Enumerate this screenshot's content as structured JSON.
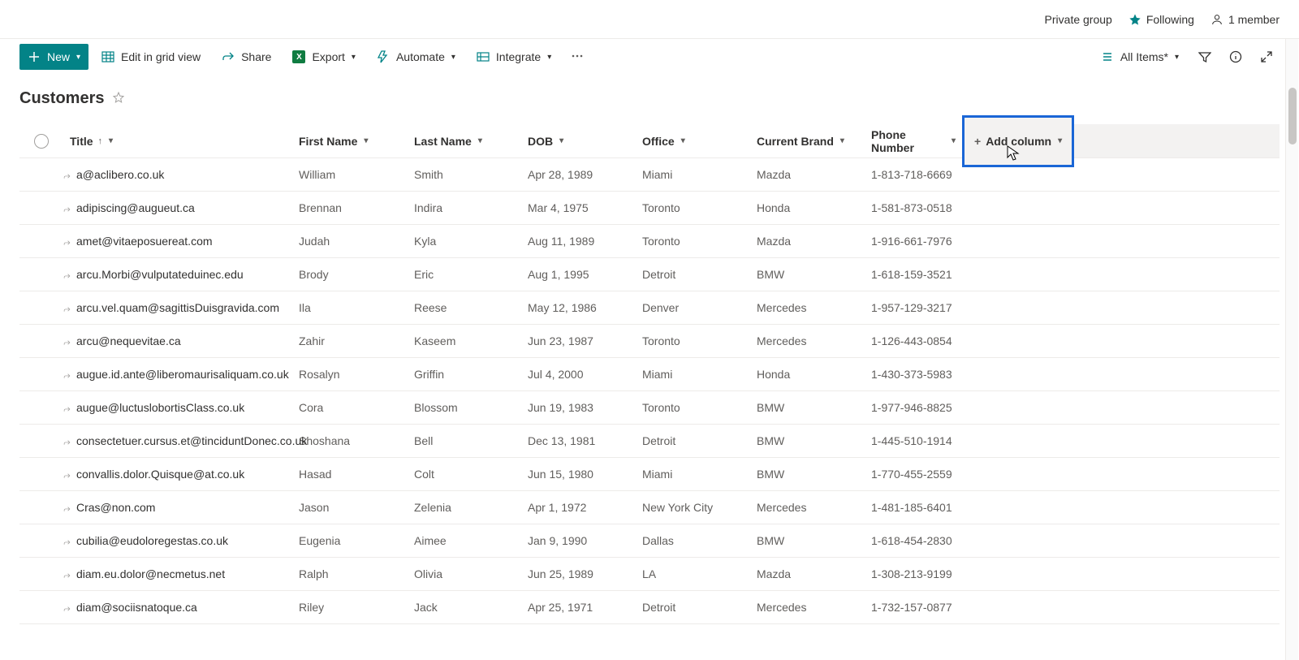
{
  "topbar": {
    "group_label": "Private group",
    "following_label": "Following",
    "members_label": "1 member"
  },
  "cmdbar": {
    "new": "New",
    "edit_grid": "Edit in grid view",
    "share": "Share",
    "export": "Export",
    "automate": "Automate",
    "integrate": "Integrate",
    "view_label": "All Items*"
  },
  "list": {
    "title": "Customers"
  },
  "columns": {
    "title": "Title",
    "first": "First Name",
    "last": "Last Name",
    "dob": "DOB",
    "office": "Office",
    "brand": "Current Brand",
    "phone": "Phone Number",
    "add": "Add column"
  },
  "rows": [
    {
      "title": "a@aclibero.co.uk",
      "first": "William",
      "last": "Smith",
      "dob": "Apr 28, 1989",
      "office": "Miami",
      "brand": "Mazda",
      "phone": "1-813-718-6669"
    },
    {
      "title": "adipiscing@augueut.ca",
      "first": "Brennan",
      "last": "Indira",
      "dob": "Mar 4, 1975",
      "office": "Toronto",
      "brand": "Honda",
      "phone": "1-581-873-0518"
    },
    {
      "title": "amet@vitaeposuereat.com",
      "first": "Judah",
      "last": "Kyla",
      "dob": "Aug 11, 1989",
      "office": "Toronto",
      "brand": "Mazda",
      "phone": "1-916-661-7976"
    },
    {
      "title": "arcu.Morbi@vulputateduinec.edu",
      "first": "Brody",
      "last": "Eric",
      "dob": "Aug 1, 1995",
      "office": "Detroit",
      "brand": "BMW",
      "phone": "1-618-159-3521"
    },
    {
      "title": "arcu.vel.quam@sagittisDuisgravida.com",
      "first": "Ila",
      "last": "Reese",
      "dob": "May 12, 1986",
      "office": "Denver",
      "brand": "Mercedes",
      "phone": "1-957-129-3217"
    },
    {
      "title": "arcu@nequevitae.ca",
      "first": "Zahir",
      "last": "Kaseem",
      "dob": "Jun 23, 1987",
      "office": "Toronto",
      "brand": "Mercedes",
      "phone": "1-126-443-0854"
    },
    {
      "title": "augue.id.ante@liberomaurisaliquam.co.uk",
      "first": "Rosalyn",
      "last": "Griffin",
      "dob": "Jul 4, 2000",
      "office": "Miami",
      "brand": "Honda",
      "phone": "1-430-373-5983"
    },
    {
      "title": "augue@luctuslobortisClass.co.uk",
      "first": "Cora",
      "last": "Blossom",
      "dob": "Jun 19, 1983",
      "office": "Toronto",
      "brand": "BMW",
      "phone": "1-977-946-8825"
    },
    {
      "title": "consectetuer.cursus.et@tinciduntDonec.co.uk",
      "first": "Shoshana",
      "last": "Bell",
      "dob": "Dec 13, 1981",
      "office": "Detroit",
      "brand": "BMW",
      "phone": "1-445-510-1914"
    },
    {
      "title": "convallis.dolor.Quisque@at.co.uk",
      "first": "Hasad",
      "last": "Colt",
      "dob": "Jun 15, 1980",
      "office": "Miami",
      "brand": "BMW",
      "phone": "1-770-455-2559"
    },
    {
      "title": "Cras@non.com",
      "first": "Jason",
      "last": "Zelenia",
      "dob": "Apr 1, 1972",
      "office": "New York City",
      "brand": "Mercedes",
      "phone": "1-481-185-6401"
    },
    {
      "title": "cubilia@eudoloregestas.co.uk",
      "first": "Eugenia",
      "last": "Aimee",
      "dob": "Jan 9, 1990",
      "office": "Dallas",
      "brand": "BMW",
      "phone": "1-618-454-2830"
    },
    {
      "title": "diam.eu.dolor@necmetus.net",
      "first": "Ralph",
      "last": "Olivia",
      "dob": "Jun 25, 1989",
      "office": "LA",
      "brand": "Mazda",
      "phone": "1-308-213-9199"
    },
    {
      "title": "diam@sociisnatoque.ca",
      "first": "Riley",
      "last": "Jack",
      "dob": "Apr 25, 1971",
      "office": "Detroit",
      "brand": "Mercedes",
      "phone": "1-732-157-0877"
    }
  ]
}
